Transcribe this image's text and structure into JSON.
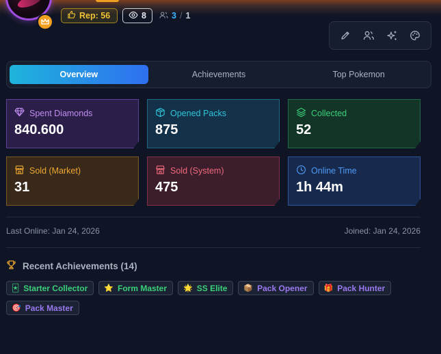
{
  "profile": {
    "reputation_label": "Rep: 56",
    "views_count": "8",
    "friends_online": "3",
    "friends_separator": "/",
    "friends_total": "1"
  },
  "toolbar": {
    "icons": [
      "pencil-icon",
      "users-icon",
      "sparkles-icon",
      "palette-icon"
    ]
  },
  "tabs": [
    {
      "label": "Overview",
      "active": true
    },
    {
      "label": "Achievements",
      "active": false
    },
    {
      "label": "Top Pokemon",
      "active": false
    }
  ],
  "stats": [
    {
      "label": "Spent Diamonds",
      "value": "840.600",
      "icon": "diamond-icon",
      "color": "#c08cf0"
    },
    {
      "label": "Opened Packs",
      "value": "875",
      "icon": "box-icon",
      "color": "#2ec5d8"
    },
    {
      "label": "Collected",
      "value": "52",
      "icon": "layers-icon",
      "color": "#3ad07a"
    },
    {
      "label": "Sold (Market)",
      "value": "31",
      "icon": "store-icon",
      "color": "#f0a830"
    },
    {
      "label": "Sold (System)",
      "value": "475",
      "icon": "store-icon",
      "color": "#f06a7a"
    },
    {
      "label": "Online Time",
      "value": "1h 44m",
      "icon": "clock-icon",
      "color": "#4e9af5"
    }
  ],
  "meta": {
    "last_online": "Last Online: Jan 24, 2026",
    "joined": "Joined: Jan 24, 2026"
  },
  "achievements": {
    "title": "Recent Achievements (14)",
    "items": [
      {
        "emoji": "🃏",
        "label": "Starter Collector",
        "color": "green"
      },
      {
        "emoji": "⭐",
        "label": "Form Master",
        "color": "green"
      },
      {
        "emoji": "🌟",
        "label": "SS Elite",
        "color": "green"
      },
      {
        "emoji": "📦",
        "label": "Pack Opener",
        "color": "purple"
      },
      {
        "emoji": "🎁",
        "label": "Pack Hunter",
        "color": "purple"
      },
      {
        "emoji": "🎯",
        "label": "Pack Master",
        "color": "purple"
      }
    ]
  }
}
